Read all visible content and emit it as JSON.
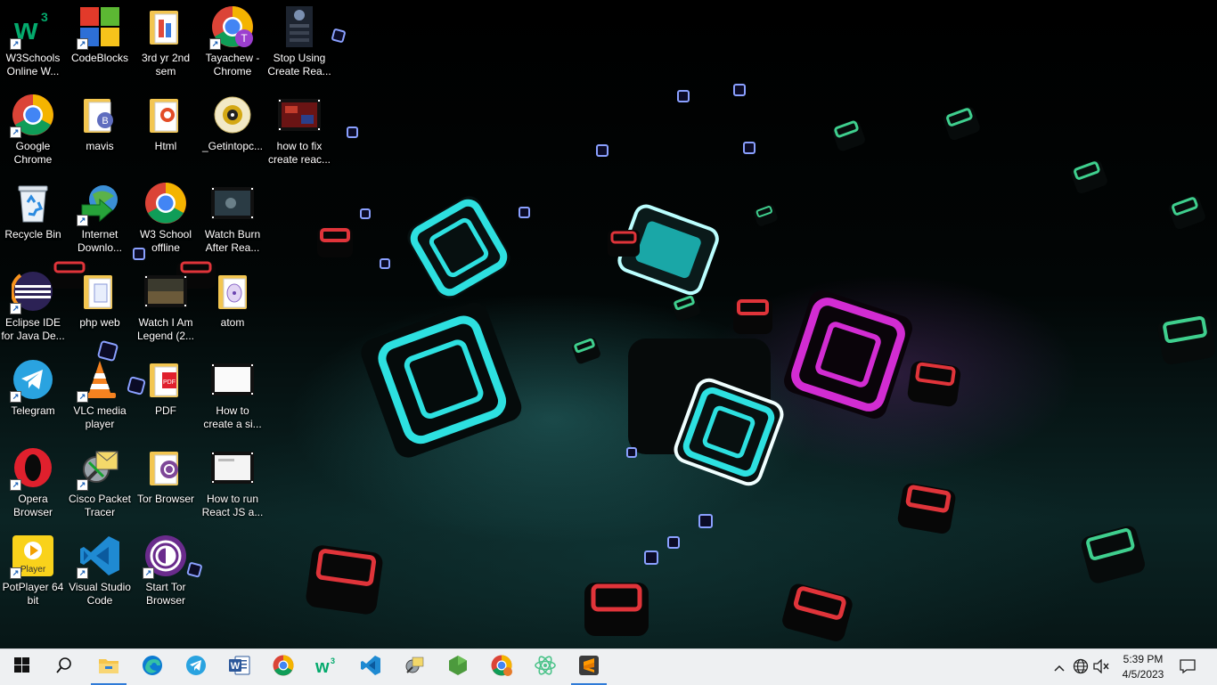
{
  "desktop": {
    "icons": [
      {
        "label": "W3Schools Online W..."
      },
      {
        "label": "CodeBlocks"
      },
      {
        "label": "3rd yr 2nd sem"
      },
      {
        "label": "Tayachew - Chrome"
      },
      {
        "label": "Stop Using Create Rea..."
      },
      {
        "label": "Google Chrome"
      },
      {
        "label": "mavis"
      },
      {
        "label": "Html"
      },
      {
        "label": "_Getintopc..."
      },
      {
        "label": "how to fix create reac..."
      },
      {
        "label": "Recycle Bin"
      },
      {
        "label": "Internet Downlo..."
      },
      {
        "label": "W3 School offline"
      },
      {
        "label": "Watch Burn After Rea..."
      },
      {
        "label": "Eclipse IDE for Java De..."
      },
      {
        "label": "php web"
      },
      {
        "label": "Watch I Am Legend (2..."
      },
      {
        "label": "atom"
      },
      {
        "label": "Telegram"
      },
      {
        "label": "VLC media player"
      },
      {
        "label": "PDF"
      },
      {
        "label": "How to create a si..."
      },
      {
        "label": "Opera Browser"
      },
      {
        "label": "Cisco Packet Tracer"
      },
      {
        "label": "Tor Browser"
      },
      {
        "label": "How to run React JS a..."
      },
      {
        "label": "PotPlayer 64 bit"
      },
      {
        "label": "Visual Studio Code"
      },
      {
        "label": "Start Tor Browser"
      }
    ]
  },
  "icon_glyphs": {
    "w3": "w³",
    "tayachew_badge": "T",
    "pdf": "PDF",
    "potplayer": "Player",
    "shortcut_arrow": "↗"
  },
  "taskbar": {
    "time": "5:39 PM",
    "date": "4/5/2023"
  },
  "colors": {
    "taskbar_bg": "#eef0f2",
    "accent_blue": "#2f7bd8",
    "neon_cyan": "#2de0e0",
    "neon_magenta": "#d22cd2",
    "neon_green": "#3fcf8e",
    "neon_red": "#e0343a"
  }
}
